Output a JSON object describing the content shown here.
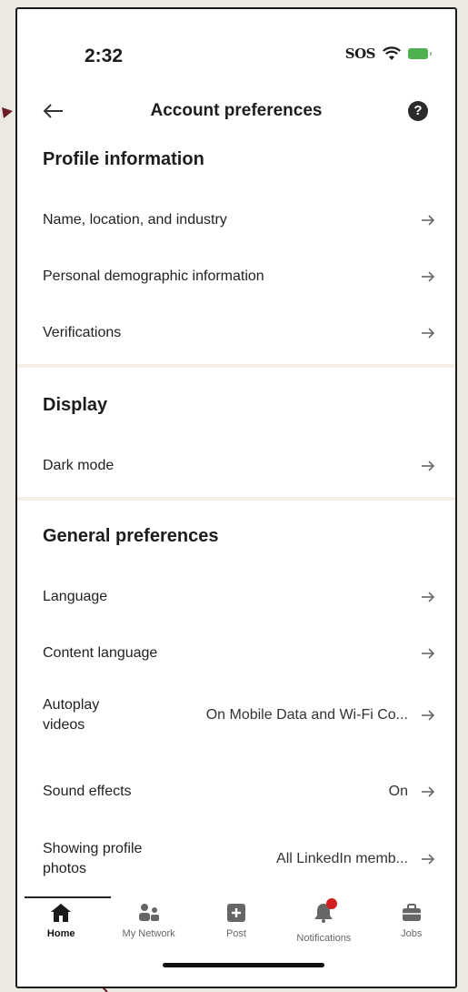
{
  "status_bar": {
    "time": "2:32",
    "carrier": "SOS",
    "battery_color": "#4caf50"
  },
  "header": {
    "title": "Account preferences",
    "back_icon": "arrow-left-icon",
    "help_icon": "question-circle-icon",
    "help_glyph": "?"
  },
  "sections": {
    "profile": {
      "title": "Profile information",
      "items": [
        {
          "label": "Name, location, and industry"
        },
        {
          "label": "Personal demographic information"
        },
        {
          "label": "Verifications"
        }
      ]
    },
    "display": {
      "title": "Display",
      "items": [
        {
          "label": "Dark mode"
        }
      ]
    },
    "general": {
      "title": "General preferences",
      "items": [
        {
          "label": "Language",
          "value": ""
        },
        {
          "label": "Content language",
          "value": ""
        },
        {
          "label": "Autoplay videos",
          "value": "On Mobile Data and Wi-Fi Co..."
        },
        {
          "label": "Sound effects",
          "value": "On"
        },
        {
          "label": "Showing profile photos",
          "value": "All LinkedIn memb..."
        }
      ]
    }
  },
  "bottom_nav": {
    "items": [
      {
        "label": "Home",
        "icon": "home-icon",
        "active": true
      },
      {
        "label": "My Network",
        "icon": "network-icon",
        "active": false
      },
      {
        "label": "Post",
        "icon": "plus-square-icon",
        "active": false
      },
      {
        "label": "Notifications",
        "icon": "bell-icon",
        "active": false
      },
      {
        "label": "Jobs",
        "icon": "briefcase-icon",
        "active": false
      }
    ],
    "badge_color": "#d11f1f"
  }
}
